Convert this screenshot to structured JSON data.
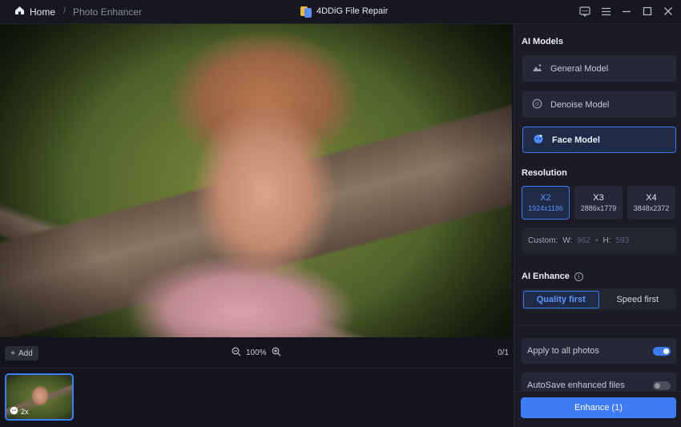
{
  "titlebar": {
    "home_label": "Home",
    "separator": "/",
    "breadcrumb": "Photo Enhancer",
    "app_name": "4DDiG File Repair",
    "icons": [
      "feedback-icon",
      "menu-icon",
      "minimize-icon",
      "maximize-icon",
      "close-icon"
    ]
  },
  "toolbar": {
    "add_label": "Add",
    "zoom_level": "100%",
    "counter": "0/1"
  },
  "thumbnail": {
    "badge": "2x"
  },
  "panel": {
    "ai_models_title": "AI Models",
    "models": [
      {
        "label": "General Model",
        "icon": "landscape-icon",
        "active": false
      },
      {
        "label": "Denoise Model",
        "icon": "circle-icon",
        "active": false
      },
      {
        "label": "Face Model",
        "icon": "face-icon",
        "active": true
      }
    ],
    "resolution_title": "Resolution",
    "resolutions": [
      {
        "scale": "X2",
        "dims": "1924x1186",
        "active": true
      },
      {
        "scale": "X3",
        "dims": "2886x1779",
        "active": false
      },
      {
        "scale": "X4",
        "dims": "3848x2372",
        "active": false
      }
    ],
    "custom": {
      "label": "Custom:",
      "w_label": "W:",
      "w_value": "962",
      "dot": "•",
      "h_label": "H:",
      "h_value": "593"
    },
    "ai_enhance_title": "AI Enhance",
    "enhance_options": [
      {
        "label": "Quality first",
        "active": true
      },
      {
        "label": "Speed first",
        "active": false
      }
    ],
    "apply_all_label": "Apply to all photos",
    "apply_all_on": true,
    "autosave_label": "AutoSave enhanced files",
    "autosave_on": false,
    "enhance_button": "Enhance (1)"
  },
  "colors": {
    "accent": "#3d7cf5",
    "background": "#13141c",
    "panel": "#1a1b25"
  }
}
